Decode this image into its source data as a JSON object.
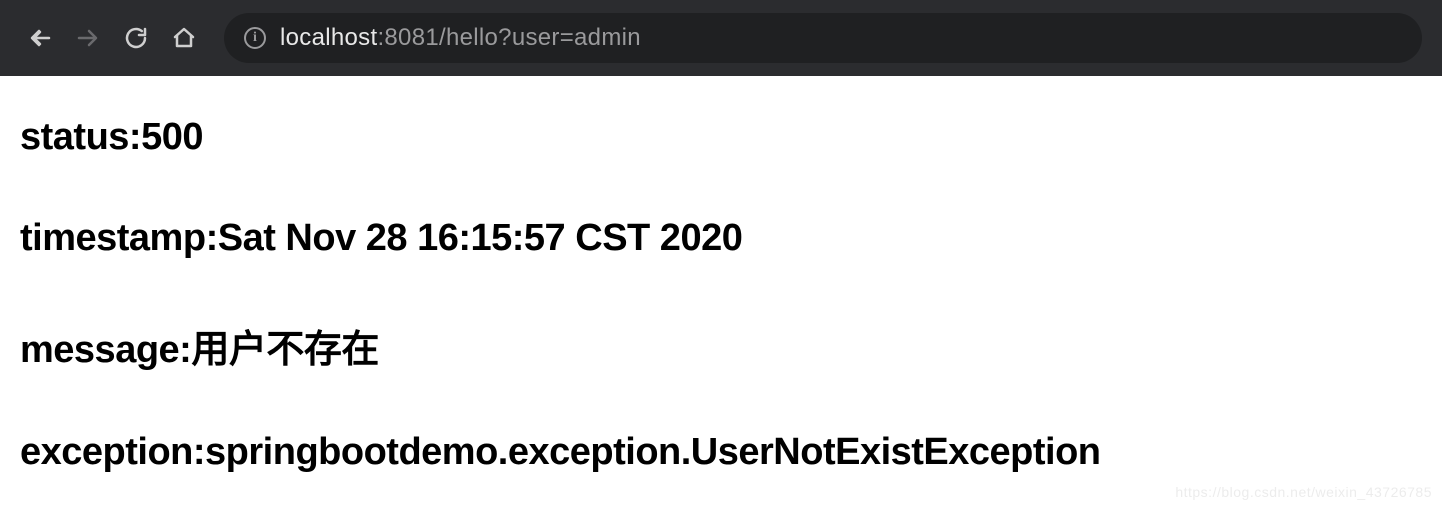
{
  "browser": {
    "url_host": "localhost",
    "url_rest": ":8081/hello?user=admin",
    "info_glyph": "i"
  },
  "page": {
    "lines": [
      {
        "label": "status",
        "value": "500"
      },
      {
        "label": "timestamp",
        "value": "Sat Nov 28 16:15:57 CST 2020"
      },
      {
        "label": "message",
        "value": "用户不存在"
      },
      {
        "label": "exception",
        "value": "springbootdemo.exception.UserNotExistException"
      }
    ]
  },
  "watermark": "https://blog.csdn.net/weixin_43726785"
}
